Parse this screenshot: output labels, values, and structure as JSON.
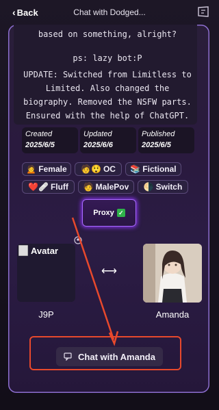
{
  "header": {
    "back_label": "Back",
    "title": "Chat with Dodged..."
  },
  "description": {
    "line1": "based on something, alright?",
    "line2": "ps: lazy bot:P",
    "update_lines": [
      "UPDATE: Switched from Limitless to",
      "Limited. Also changed the",
      "biography. Removed the NSFW parts.",
      "Ensured with the help of ChatGPT."
    ]
  },
  "stats": {
    "created_label": "Created",
    "created_value": "2025/6/5",
    "updated_label": "Updated",
    "updated_value": "2025/6/6",
    "published_label": "Published",
    "published_value": "2025/6/5"
  },
  "tags": [
    {
      "emoji": "🙍",
      "label": "Female"
    },
    {
      "emoji": "🧑😲",
      "label": "OC"
    },
    {
      "emoji": "📚",
      "label": "Fictional"
    },
    {
      "emoji": "❤️🩹",
      "label": "Fluff"
    },
    {
      "emoji": "🧑",
      "label": "MalePov"
    },
    {
      "emoji": "🌗",
      "label": "Switch"
    }
  ],
  "proxy": {
    "label": "Proxy",
    "check": "✓"
  },
  "participants": {
    "left_alt": "Avatar",
    "left_name": "J9P",
    "right_name": "Amanda"
  },
  "chat_button": {
    "label": "Chat with Amanda"
  },
  "colors": {
    "accent": "#8d6fd0",
    "highlight": "#e8492c",
    "proxy_glow": "#7a2fd6"
  }
}
